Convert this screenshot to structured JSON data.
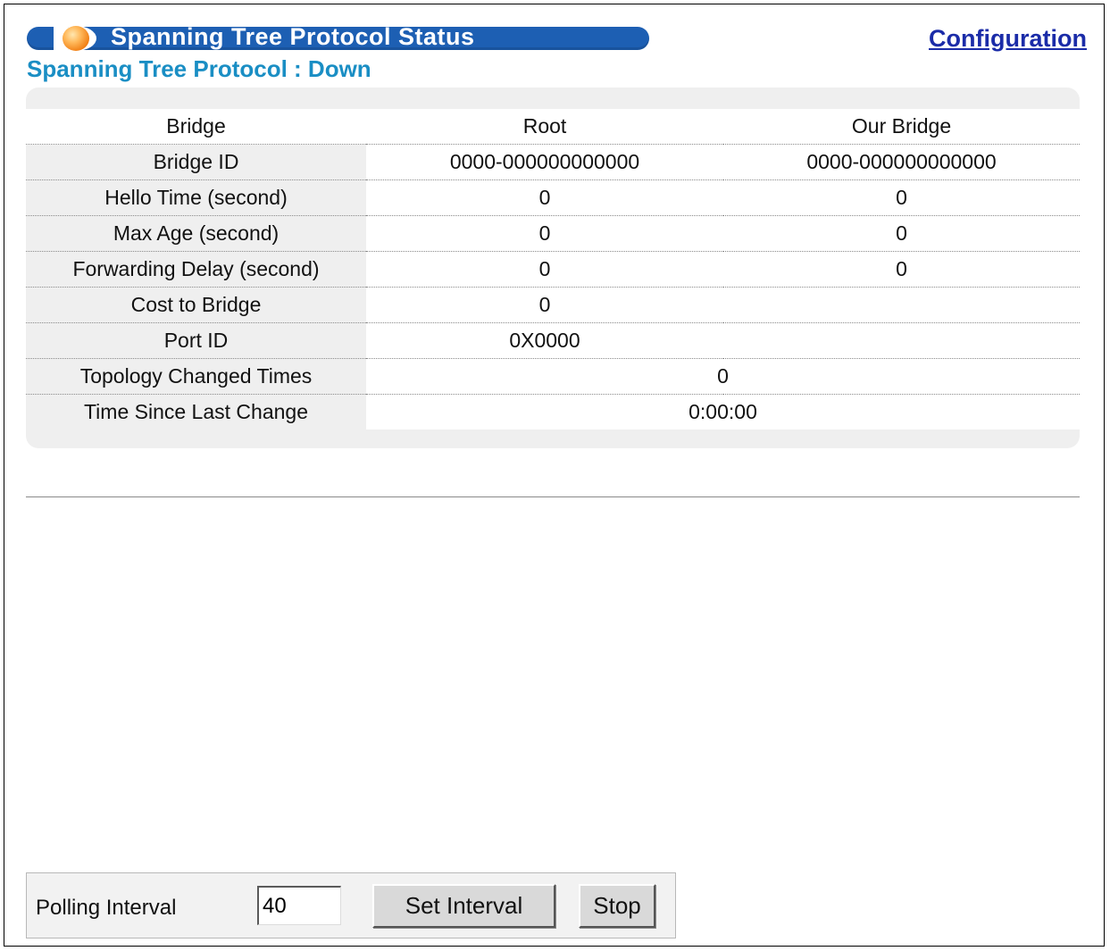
{
  "header": {
    "banner_title": "Spanning Tree Protocol Status",
    "config_link": "Configuration",
    "status_heading": "Spanning Tree Protocol : Down"
  },
  "table": {
    "columns": [
      "Bridge",
      "Root",
      "Our Bridge"
    ],
    "rows": [
      {
        "label": "Bridge ID",
        "root": "0000-000000000000",
        "our": "0000-000000000000"
      },
      {
        "label": "Hello Time (second)",
        "root": "0",
        "our": "0"
      },
      {
        "label": "Max Age (second)",
        "root": "0",
        "our": "0"
      },
      {
        "label": "Forwarding Delay (second)",
        "root": "0",
        "our": "0"
      },
      {
        "label": "Cost to Bridge",
        "root": "0"
      },
      {
        "label": "Port ID",
        "root": "0X0000"
      },
      {
        "label": "Topology Changed Times",
        "value": "0"
      },
      {
        "label": "Time Since Last Change",
        "value": "0:00:00"
      }
    ]
  },
  "polling": {
    "label": "Polling Interval",
    "interval_value": "40",
    "set_button": "Set Interval",
    "stop_button": "Stop"
  },
  "colors": {
    "banner": "#1d5fb3",
    "heading": "#1a8ec4",
    "link": "#1b2ca8",
    "panel": "#efefef"
  },
  "icons": {
    "banner_orb": "orange-orb-icon"
  }
}
